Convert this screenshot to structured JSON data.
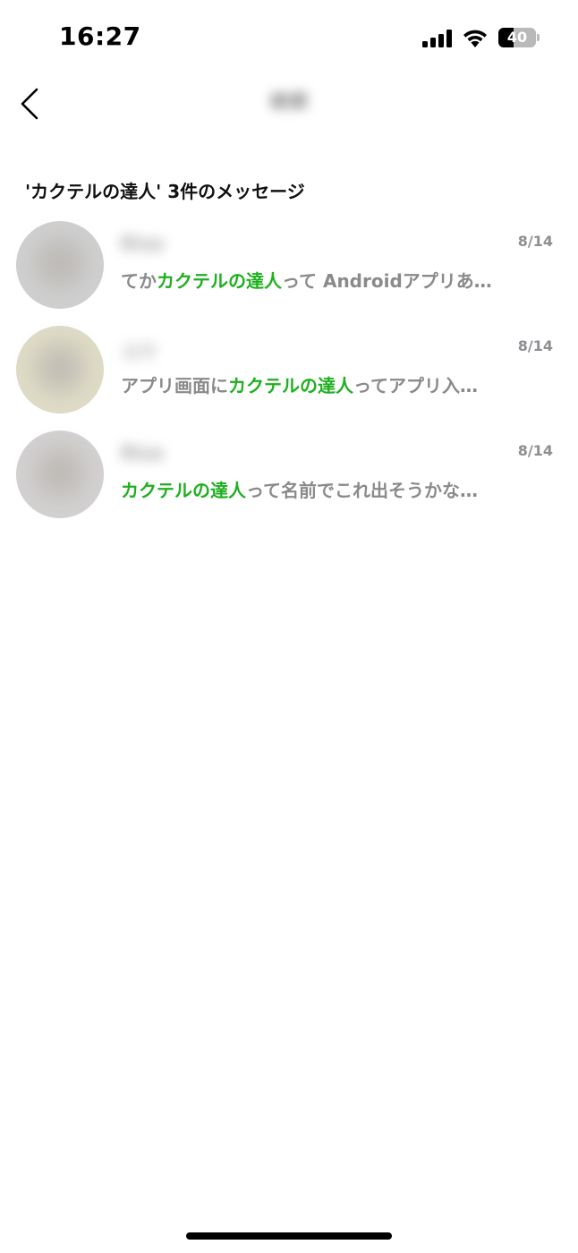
{
  "status_bar": {
    "time": "16:27",
    "battery_level": "40",
    "battery_fraction": 0.4,
    "icons": [
      "cellular-signal-icon",
      "wifi-icon",
      "battery-icon"
    ]
  },
  "nav": {
    "back_icon": "chevron-left-icon",
    "title": "検索"
  },
  "results_header": "'カクテルの達人' 3件のメッセージ",
  "colors": {
    "highlight": "#1fb01f",
    "snippet_text": "#8a8a8a",
    "date_text": "#8e8e93"
  },
  "results": [
    {
      "sender": "Risa",
      "date": "8/14",
      "avatar_color": "#cfcfcf",
      "snippet_before": "てか",
      "snippet_match": "カクテルの達人",
      "snippet_after": "って Androidアプリあ…"
    },
    {
      "sender": "ユウ",
      "date": "8/14",
      "avatar_color": "#dedbc6",
      "snippet_before": "アプリ画面に",
      "snippet_match": "カクテルの達人",
      "snippet_after": "ってアプリ入…"
    },
    {
      "sender": "Risa",
      "date": "8/14",
      "avatar_color": "#d2d0d0",
      "snippet_before": "",
      "snippet_match": "カクテルの達人",
      "snippet_after": "って名前でこれ出そうかな…"
    }
  ]
}
